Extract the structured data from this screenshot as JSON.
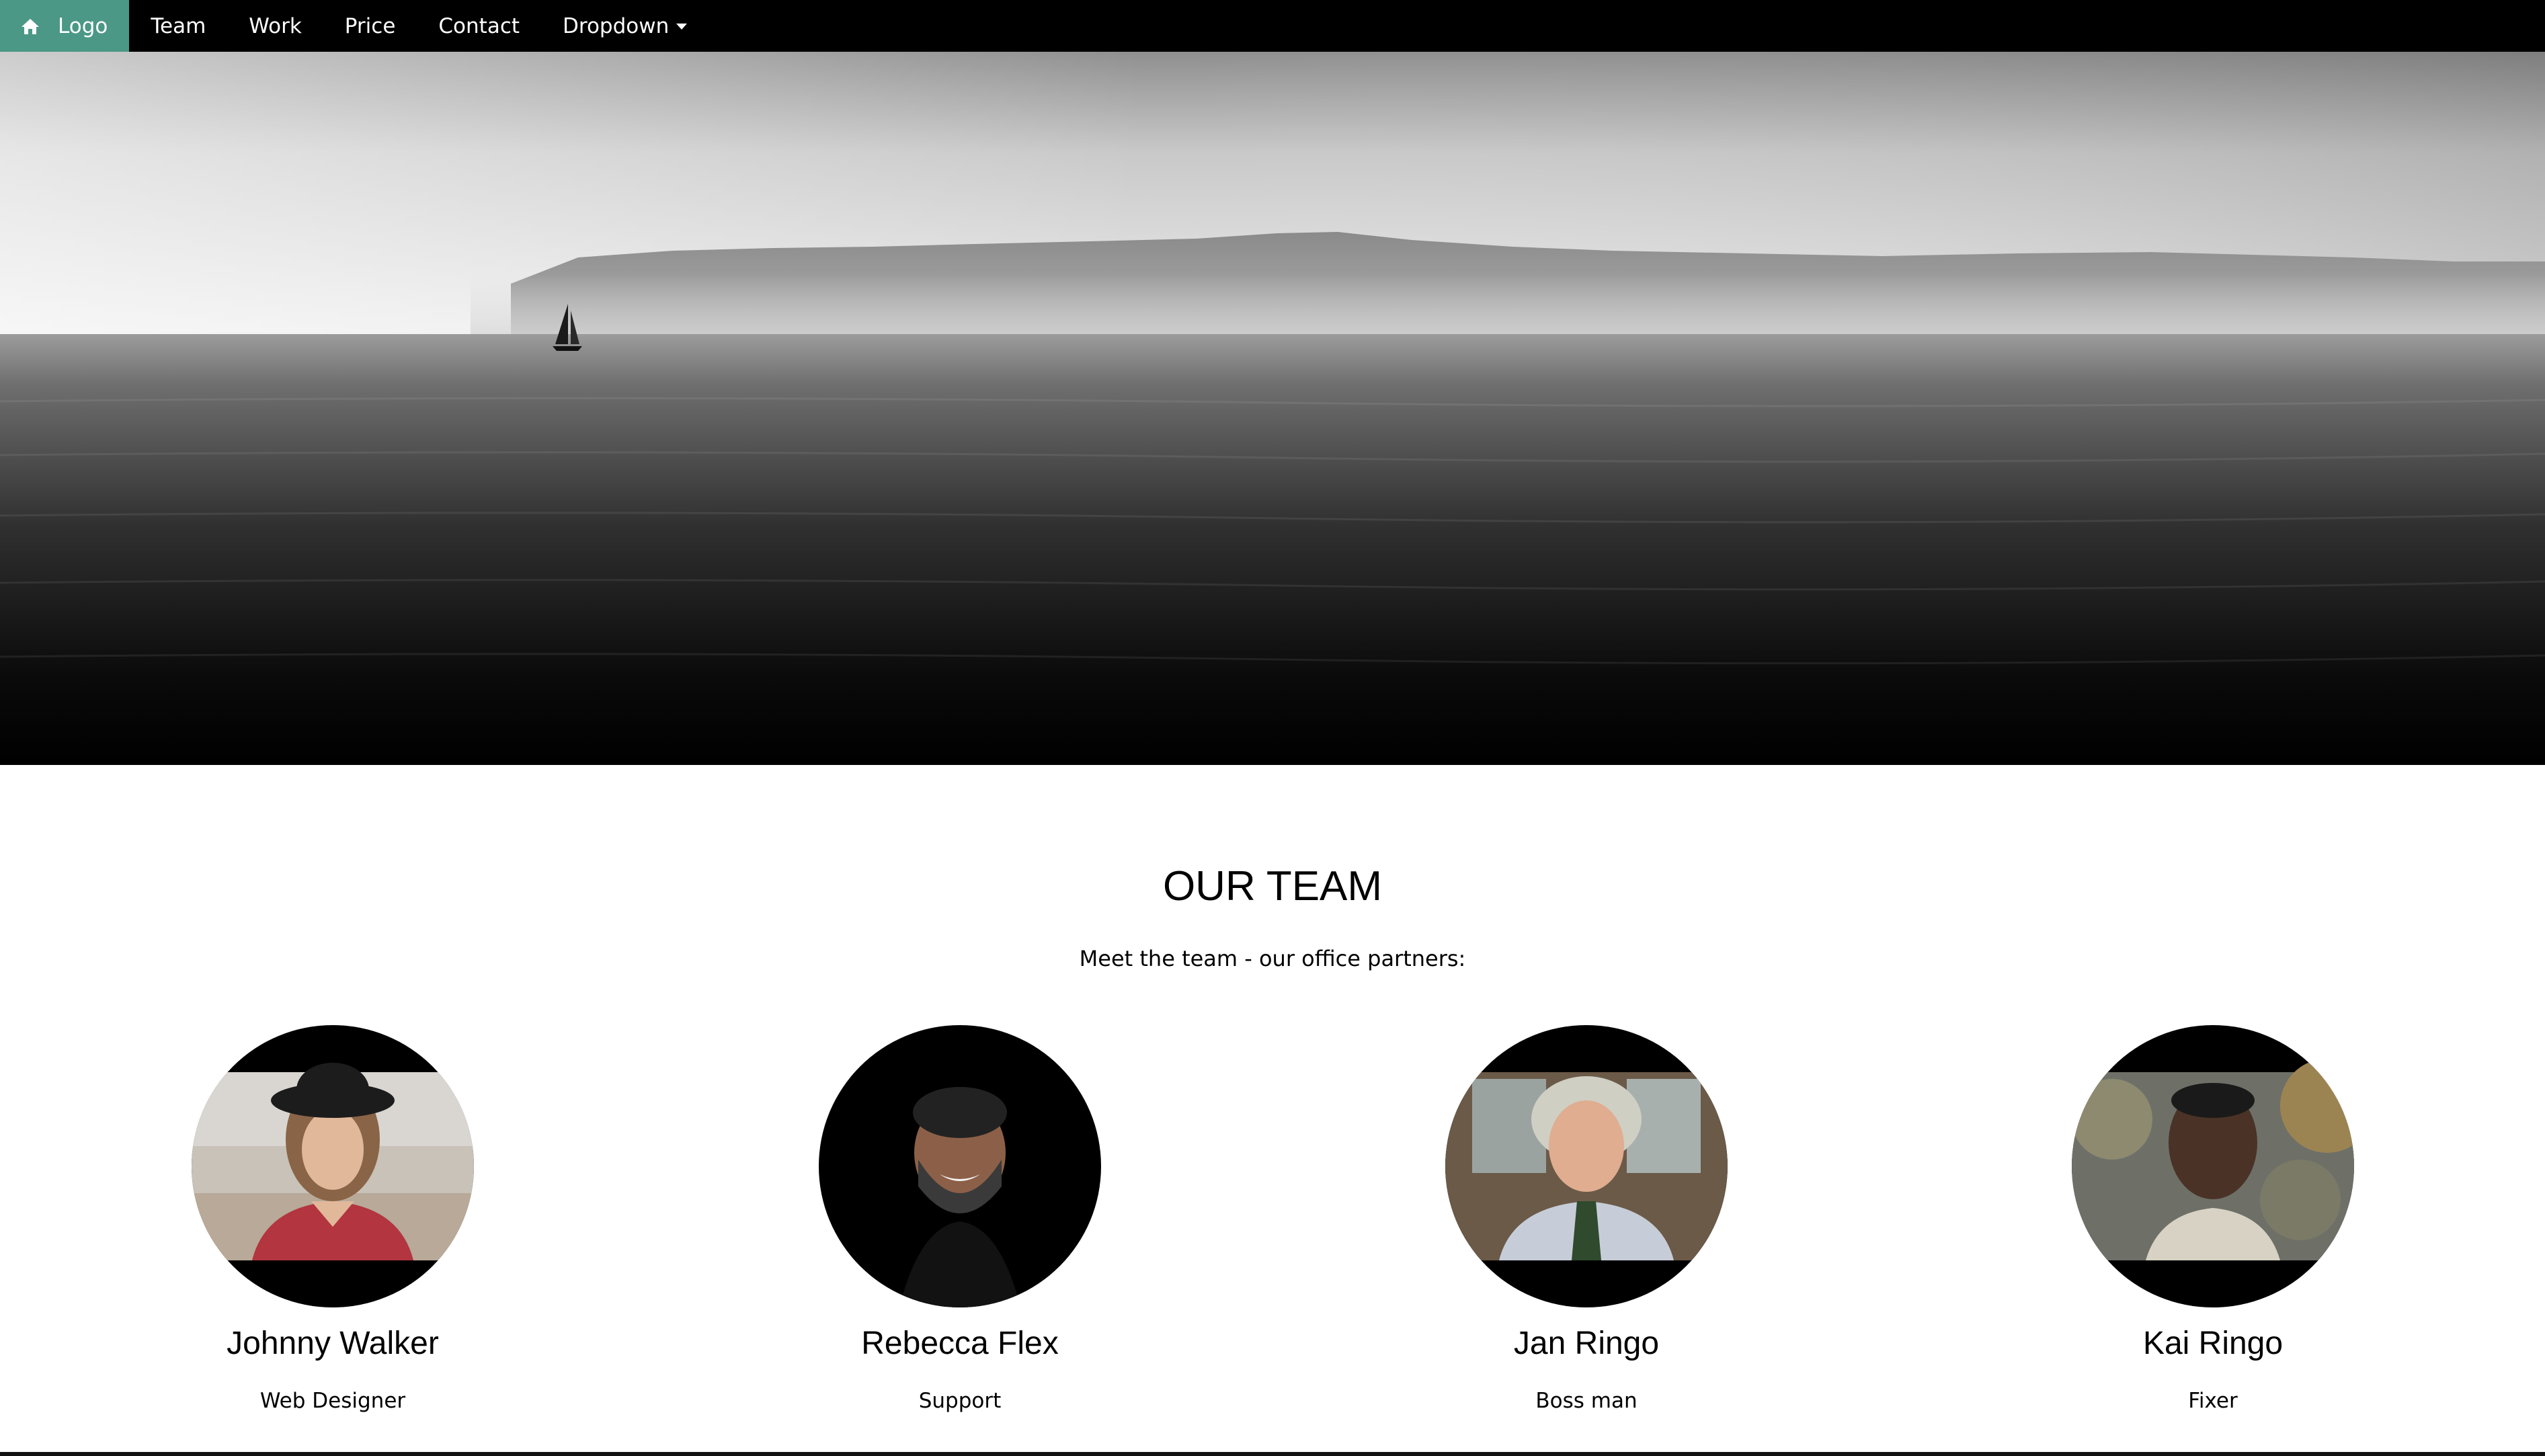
{
  "nav": {
    "logo_label": "Logo",
    "logo_icon": "home-icon",
    "logo_bg": "#4b9887",
    "items": [
      {
        "label": "Team"
      },
      {
        "label": "Work"
      },
      {
        "label": "Price"
      },
      {
        "label": "Contact"
      }
    ],
    "dropdown_label": "Dropdown",
    "dropdown_icon": "caret-down-icon"
  },
  "hero": {
    "image": "black-and-white seascape with sailboat and distant mountains"
  },
  "team": {
    "title": "OUR TEAM",
    "subtitle": "Meet the team - our office partners:",
    "members": [
      {
        "name": "Johnny Walker",
        "role": "Web Designer"
      },
      {
        "name": "Rebecca Flex",
        "role": "Support"
      },
      {
        "name": "Jan Ringo",
        "role": "Boss man"
      },
      {
        "name": "Kai Ringo",
        "role": "Fixer"
      }
    ]
  }
}
